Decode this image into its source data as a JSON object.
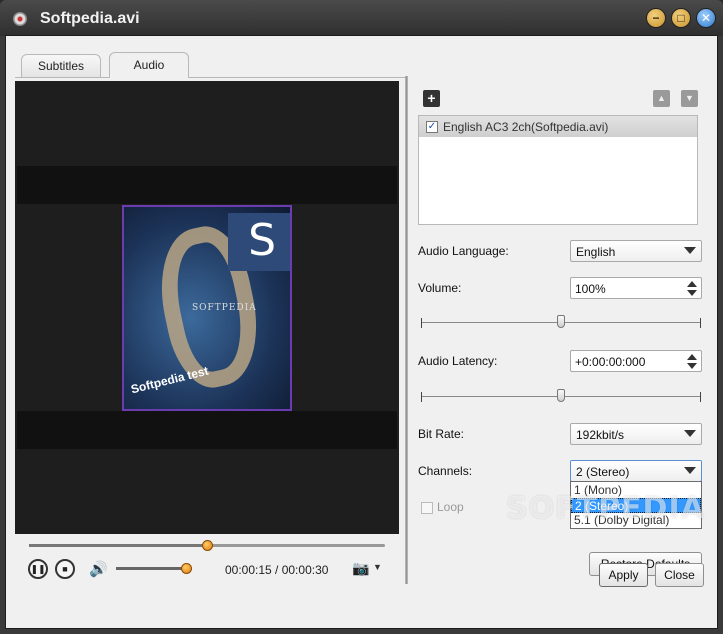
{
  "window": {
    "title": "Softpedia.avi",
    "controls": {
      "minimize": "−",
      "maximize": "□",
      "close": "✕"
    }
  },
  "tabs": [
    {
      "label": "Subtitles",
      "active": false
    },
    {
      "label": "Audio",
      "active": true
    }
  ],
  "player": {
    "poster_logo": "S",
    "poster_text": "SOFTPEDIA",
    "poster_caption": "Softpedia test",
    "time": "00:00:15 / 00:00:30",
    "seek_fraction": 0.5,
    "volume_fraction": 1.0,
    "icons": {
      "pause": "pause-icon",
      "stop": "stop-icon",
      "volume": "speaker-icon",
      "snapshot": "camera-icon"
    }
  },
  "audio": {
    "toolbar": {
      "add": "+",
      "move_up": "▲",
      "move_down": "▼"
    },
    "tracks": [
      {
        "label": "English AC3 2ch(Softpedia.avi)",
        "checked": true
      }
    ],
    "language_label": "Audio Language:",
    "language_value": "English",
    "volume_label": "Volume:",
    "volume_value": "100%",
    "volume_slider_fraction": 0.5,
    "latency_label": "Audio Latency:",
    "latency_value": "+0:00:00:000",
    "latency_slider_fraction": 0.5,
    "bitrate_label": "Bit Rate:",
    "bitrate_value": "192kbit/s",
    "channels_label": "Channels:",
    "channels_value": "2 (Stereo)",
    "channels_options": [
      "1 (Mono)",
      "2 (Stereo)",
      "5.1 (Dolby Digital)"
    ],
    "loop_label": "Loop",
    "restore_label": "Restore Defaults"
  },
  "footer": {
    "apply_label": "Apply",
    "close_label": "Close"
  },
  "watermark": "SOFTPEDIA",
  "colors": {
    "progress_knob": "#e07a10",
    "selection": "#3399ff",
    "poster_border": "#6a3cb0"
  }
}
